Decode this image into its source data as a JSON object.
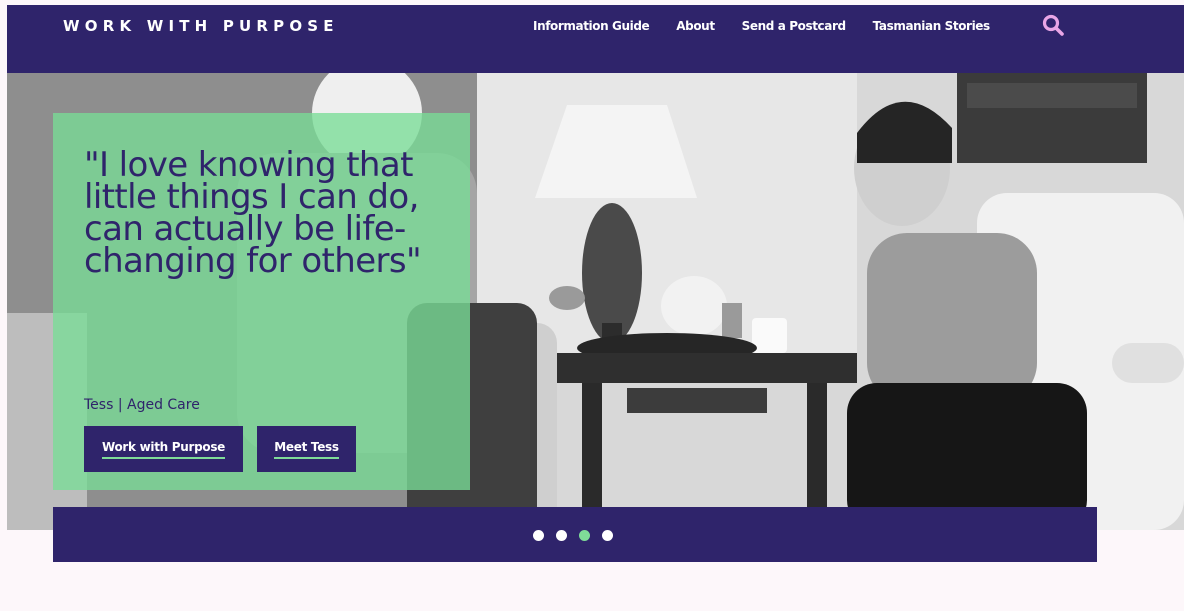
{
  "header": {
    "brand": "WORK WITH PURPOSE",
    "nav": [
      {
        "label": "Information Guide"
      },
      {
        "label": "About"
      },
      {
        "label": "Send a Postcard"
      },
      {
        "label": "Tasmanian Stories"
      }
    ],
    "search_icon": "search-icon"
  },
  "hero": {
    "quote": "\"I love knowing that little things I can do, can actually be life-changing for others\"",
    "attribution": "Tess  |  Aged Care",
    "buttons": {
      "primary": "Work with Purpose",
      "secondary": "Meet Tess"
    },
    "photo": "black-and-white photo of a carer laughing with an elderly man beside a lamp and side table"
  },
  "carousel": {
    "total": 4,
    "active": 3
  },
  "colors": {
    "brand_purple": "#2f246b",
    "accent_green": "#7fdc98",
    "page_bg": "#fdf7fa"
  }
}
